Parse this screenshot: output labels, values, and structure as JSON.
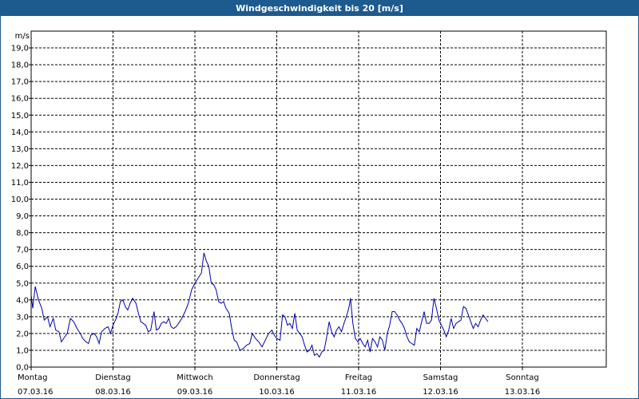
{
  "window": {
    "title": "Windgeschwindigkeit bis 20 [m/s]"
  },
  "chart_data": {
    "type": "line",
    "title": "Windgeschwindigkeit bis 20 [m/s]",
    "ylabel": "m/s",
    "ylim": [
      0,
      20
    ],
    "xlim": [
      0,
      7
    ],
    "grid": true,
    "y_ticks": [
      "0,0",
      "1,0",
      "2,0",
      "3,0",
      "4,0",
      "5,0",
      "6,0",
      "7,0",
      "8,0",
      "9,0",
      "10,0",
      "11,0",
      "12,0",
      "13,0",
      "14,0",
      "15,0",
      "16,0",
      "17,0",
      "18,0",
      "19,0"
    ],
    "x_ticks": [
      {
        "day": "Montag",
        "date": "07.03.16"
      },
      {
        "day": "Dienstag",
        "date": "08.03.16"
      },
      {
        "day": "Mittwoch",
        "date": "09.03.16"
      },
      {
        "day": "Donnerstag",
        "date": "10.03.16"
      },
      {
        "day": "Freitag",
        "date": "11.03.16"
      },
      {
        "day": "Samstag",
        "date": "12.03.16"
      },
      {
        "day": "Sonntag",
        "date": "13.03.16"
      }
    ],
    "series": [
      {
        "color": "#0000aa",
        "points": [
          [
            0.0,
            4.3
          ],
          [
            0.02,
            3.5
          ],
          [
            0.05,
            4.8
          ],
          [
            0.09,
            4.0
          ],
          [
            0.13,
            3.5
          ],
          [
            0.16,
            2.8
          ],
          [
            0.2,
            3.0
          ],
          [
            0.23,
            2.4
          ],
          [
            0.27,
            2.9
          ],
          [
            0.3,
            2.2
          ],
          [
            0.34,
            2.1
          ],
          [
            0.37,
            1.5
          ],
          [
            0.41,
            1.8
          ],
          [
            0.44,
            2.0
          ],
          [
            0.48,
            2.9
          ],
          [
            0.52,
            2.7
          ],
          [
            0.56,
            2.3
          ],
          [
            0.6,
            2.0
          ],
          [
            0.63,
            1.7
          ],
          [
            0.67,
            1.5
          ],
          [
            0.7,
            1.4
          ],
          [
            0.73,
            1.9
          ],
          [
            0.77,
            2.0
          ],
          [
            0.8,
            1.8
          ],
          [
            0.83,
            1.4
          ],
          [
            0.86,
            2.1
          ],
          [
            0.9,
            2.3
          ],
          [
            0.94,
            2.4
          ],
          [
            0.97,
            2.0
          ],
          [
            1.0,
            2.5
          ],
          [
            1.03,
            2.8
          ],
          [
            1.06,
            3.2
          ],
          [
            1.09,
            3.9
          ],
          [
            1.12,
            4.0
          ],
          [
            1.15,
            3.6
          ],
          [
            1.18,
            3.4
          ],
          [
            1.21,
            3.8
          ],
          [
            1.24,
            4.1
          ],
          [
            1.28,
            3.8
          ],
          [
            1.31,
            3.2
          ],
          [
            1.34,
            2.7
          ],
          [
            1.37,
            2.6
          ],
          [
            1.4,
            2.5
          ],
          [
            1.43,
            2.1
          ],
          [
            1.46,
            2.2
          ],
          [
            1.5,
            3.3
          ],
          [
            1.53,
            2.2
          ],
          [
            1.56,
            2.3
          ],
          [
            1.59,
            2.6
          ],
          [
            1.62,
            2.7
          ],
          [
            1.65,
            2.6
          ],
          [
            1.68,
            2.9
          ],
          [
            1.71,
            2.4
          ],
          [
            1.74,
            2.3
          ],
          [
            1.77,
            2.4
          ],
          [
            1.8,
            2.6
          ],
          [
            1.84,
            2.9
          ],
          [
            1.88,
            3.3
          ],
          [
            1.92,
            3.8
          ],
          [
            1.96,
            4.6
          ],
          [
            2.0,
            5.0
          ],
          [
            2.04,
            5.3
          ],
          [
            2.08,
            5.6
          ],
          [
            2.11,
            6.8
          ],
          [
            2.14,
            6.3
          ],
          [
            2.17,
            6.0
          ],
          [
            2.2,
            5.0
          ],
          [
            2.23,
            4.9
          ],
          [
            2.26,
            4.6
          ],
          [
            2.29,
            3.9
          ],
          [
            2.32,
            3.8
          ],
          [
            2.35,
            3.9
          ],
          [
            2.38,
            3.5
          ],
          [
            2.42,
            3.2
          ],
          [
            2.45,
            2.3
          ],
          [
            2.48,
            1.6
          ],
          [
            2.51,
            1.5
          ],
          [
            2.55,
            1.0
          ],
          [
            2.59,
            1.1
          ],
          [
            2.63,
            1.3
          ],
          [
            2.67,
            1.4
          ],
          [
            2.7,
            2.0
          ],
          [
            2.74,
            1.7
          ],
          [
            2.78,
            1.5
          ],
          [
            2.82,
            1.2
          ],
          [
            2.86,
            1.6
          ],
          [
            2.9,
            2.0
          ],
          [
            2.94,
            2.2
          ],
          [
            2.97,
            1.9
          ],
          [
            3.0,
            1.7
          ],
          [
            3.04,
            1.6
          ],
          [
            3.07,
            3.1
          ],
          [
            3.1,
            3.0
          ],
          [
            3.13,
            2.5
          ],
          [
            3.16,
            2.6
          ],
          [
            3.19,
            2.3
          ],
          [
            3.22,
            3.2
          ],
          [
            3.25,
            2.2
          ],
          [
            3.28,
            2.0
          ],
          [
            3.31,
            1.8
          ],
          [
            3.34,
            1.3
          ],
          [
            3.37,
            0.9
          ],
          [
            3.4,
            1.0
          ],
          [
            3.43,
            1.3
          ],
          [
            3.46,
            0.7
          ],
          [
            3.49,
            0.8
          ],
          [
            3.52,
            0.6
          ],
          [
            3.55,
            0.9
          ],
          [
            3.58,
            1.0
          ],
          [
            3.61,
            1.8
          ],
          [
            3.64,
            2.7
          ],
          [
            3.67,
            2.1
          ],
          [
            3.7,
            1.8
          ],
          [
            3.73,
            2.2
          ],
          [
            3.76,
            2.4
          ],
          [
            3.79,
            2.1
          ],
          [
            3.82,
            2.6
          ],
          [
            3.85,
            3.0
          ],
          [
            3.88,
            3.5
          ],
          [
            3.9,
            4.1
          ],
          [
            3.93,
            2.6
          ],
          [
            3.96,
            1.7
          ],
          [
            3.99,
            1.5
          ],
          [
            4.02,
            1.7
          ],
          [
            4.05,
            1.4
          ],
          [
            4.08,
            1.2
          ],
          [
            4.11,
            1.6
          ],
          [
            4.14,
            0.9
          ],
          [
            4.17,
            1.7
          ],
          [
            4.2,
            1.5
          ],
          [
            4.23,
            1.2
          ],
          [
            4.26,
            1.8
          ],
          [
            4.29,
            1.6
          ],
          [
            4.32,
            1.0
          ],
          [
            4.35,
            2.0
          ],
          [
            4.38,
            2.5
          ],
          [
            4.41,
            3.3
          ],
          [
            4.44,
            3.3
          ],
          [
            4.47,
            3.1
          ],
          [
            4.5,
            2.8
          ],
          [
            4.53,
            2.6
          ],
          [
            4.56,
            2.3
          ],
          [
            4.59,
            1.8
          ],
          [
            4.62,
            1.5
          ],
          [
            4.65,
            1.4
          ],
          [
            4.68,
            1.3
          ],
          [
            4.71,
            2.3
          ],
          [
            4.74,
            2.1
          ],
          [
            4.77,
            2.7
          ],
          [
            4.8,
            3.3
          ],
          [
            4.83,
            2.6
          ],
          [
            4.86,
            2.6
          ],
          [
            4.89,
            2.8
          ],
          [
            4.92,
            4.1
          ],
          [
            4.95,
            3.5
          ],
          [
            4.98,
            2.8
          ],
          [
            5.01,
            2.5
          ],
          [
            5.04,
            2.2
          ],
          [
            5.07,
            1.8
          ],
          [
            5.1,
            2.2
          ],
          [
            5.13,
            2.9
          ],
          [
            5.16,
            2.3
          ],
          [
            5.19,
            2.6
          ],
          [
            5.22,
            2.7
          ],
          [
            5.25,
            2.8
          ],
          [
            5.28,
            3.6
          ],
          [
            5.31,
            3.5
          ],
          [
            5.34,
            3.1
          ],
          [
            5.37,
            2.7
          ],
          [
            5.4,
            2.3
          ],
          [
            5.43,
            2.6
          ],
          [
            5.46,
            2.4
          ],
          [
            5.49,
            2.8
          ],
          [
            5.52,
            3.1
          ],
          [
            5.55,
            2.9
          ],
          [
            5.58,
            2.7
          ]
        ]
      }
    ]
  }
}
